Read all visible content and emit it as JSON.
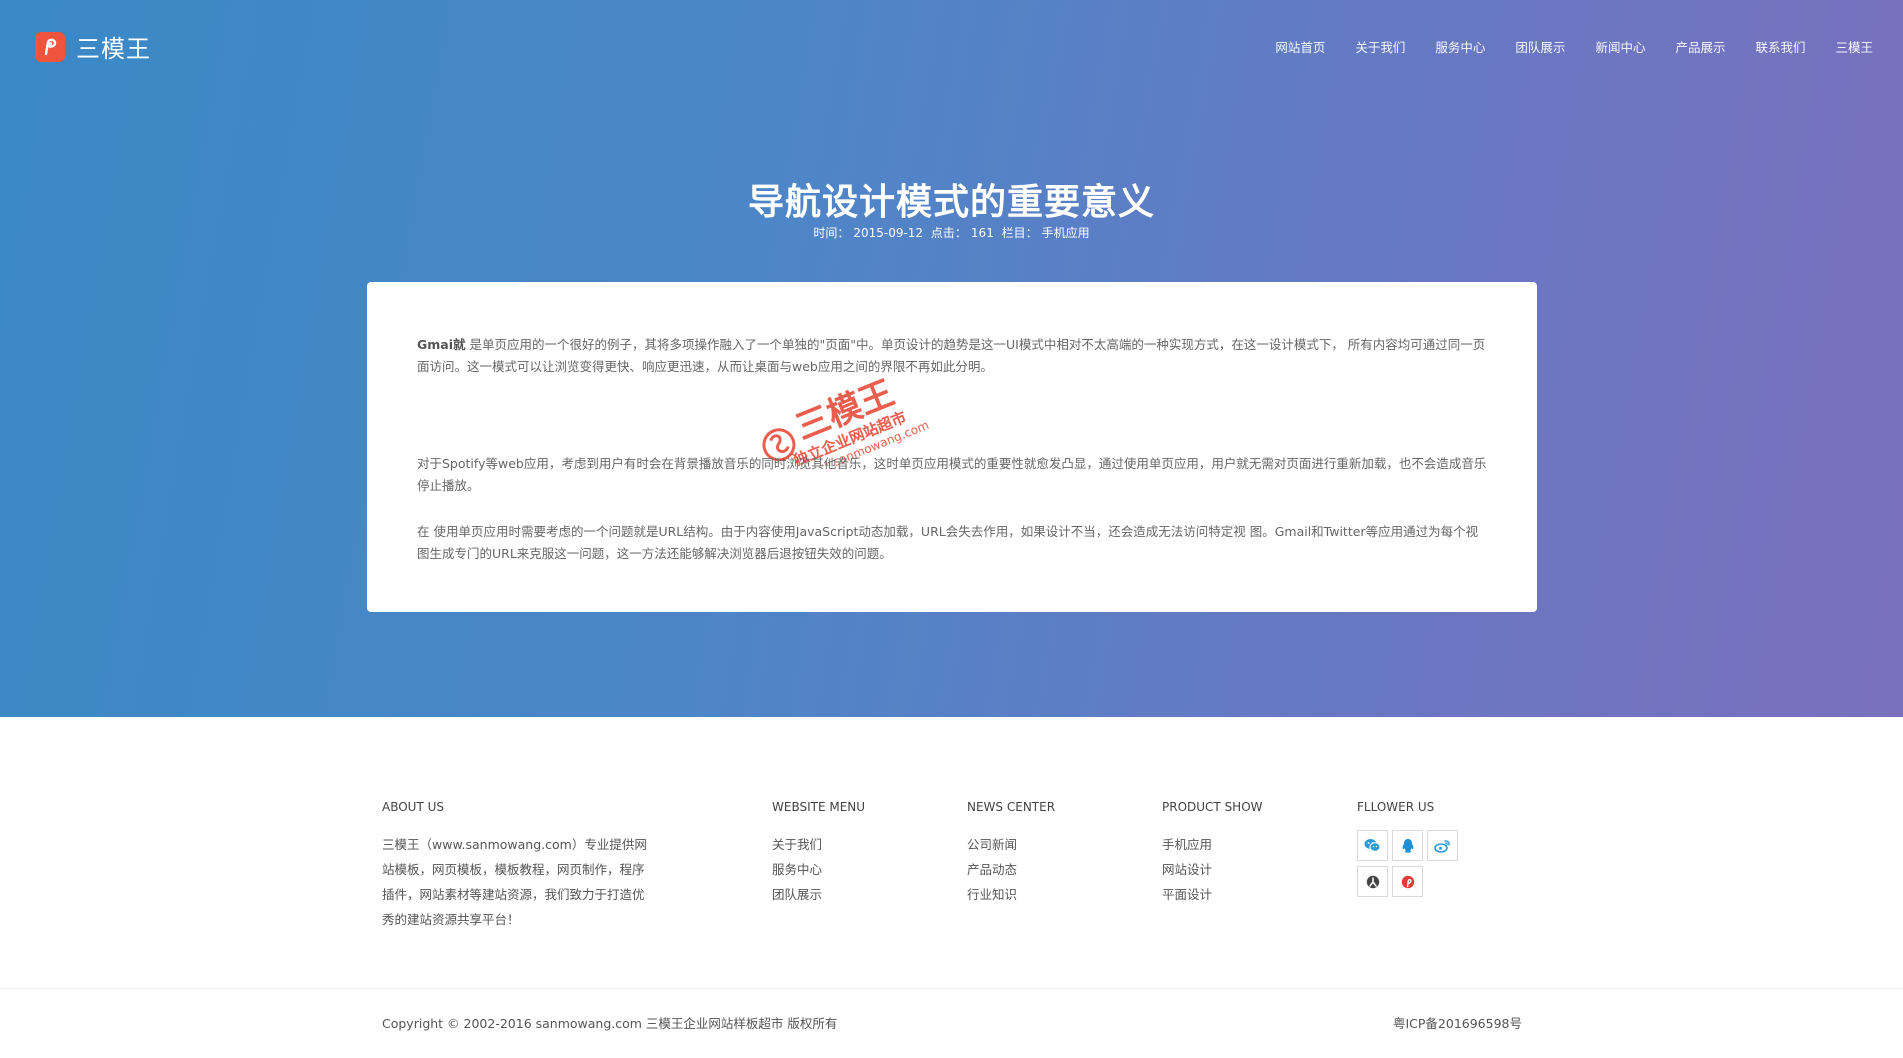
{
  "header": {
    "brand": "三模王",
    "nav": [
      "网站首页",
      "关于我们",
      "服务中心",
      "团队展示",
      "新闻中心",
      "产品展示",
      "联系我们",
      "三模王"
    ]
  },
  "article": {
    "title": "导航设计模式的重要意义",
    "meta": {
      "time_label": "时间：",
      "time": "2015-09-12",
      "clicks_label": "点击：",
      "clicks": "161",
      "column_label": "栏目：",
      "column": "手机应用"
    },
    "p1_lead": "Gmai就",
    "p1_rest": " 是单页应用的一个很好的例子，其将多项操作融入了一个单独的\"页面\"中。单页设计的趋势是这一UI模式中相对不太高端的一种实现方式，在这一设计模式下， 所有内容均可通过同一页面访问。这一模式可以让浏览变得更快、响应更迅速，从而让桌面与web应用之间的界限不再如此分明。",
    "p2": "对于Spotify等web应用，考虑到用户有时会在背景播放音乐的同时浏览其他音乐，这时单页应用模式的重要性就愈发凸显，通过使用单页应用，用户就无需对页面进行重新加载，也不会造成音乐停止播放。",
    "p3": "在 使用单页应用时需要考虑的一个问题就是URL结构。由于内容使用JavaScript动态加载，URL会失去作用，如果设计不当，还会造成无法访问特定视 图。Gmail和Twitter等应用通过为每个视图生成专门的URL来克服这一问题，这一方法还能够解决浏览器后退按钮失效的问题。",
    "watermark": {
      "main": "三模王",
      "sub": "独立企业网站超市",
      "url": "www.sanmowang.com"
    }
  },
  "footer": {
    "about": {
      "heading": "ABOUT US",
      "text": "三模王（www.sanmowang.com）专业提供网站模板，网页模板，模板教程，网页制作，程序插件，网站素材等建站资源，我们致力于打造优秀的建站资源共享平台！"
    },
    "menu": {
      "heading": "WEBSITE MENU",
      "links": [
        "关于我们",
        "服务中心",
        "团队展示"
      ]
    },
    "news": {
      "heading": "NEWS CENTER",
      "links": [
        "公司新闻",
        "产品动态",
        "行业知识"
      ]
    },
    "products": {
      "heading": "PRODUCT SHOW",
      "links": [
        "手机应用",
        "网站设计",
        "平面设计"
      ]
    },
    "follow": {
      "heading": "FLLOWER US",
      "icons": [
        "wechat-icon",
        "qq-icon",
        "weibo-icon",
        "renren-icon",
        "pinterest-icon"
      ]
    },
    "copyright": "Copyright © 2002-2016 sanmowang.com 三模王企业网站样板超市 版权所有",
    "icp": "粤ICP备201696598号"
  },
  "colors": {
    "accent": "#f0543d",
    "wechat": "#2a9bd6",
    "qq": "#1f8fd8",
    "weibo": "#2a9bd6",
    "pinterest": "#e33a3a",
    "renren": "#444444"
  }
}
